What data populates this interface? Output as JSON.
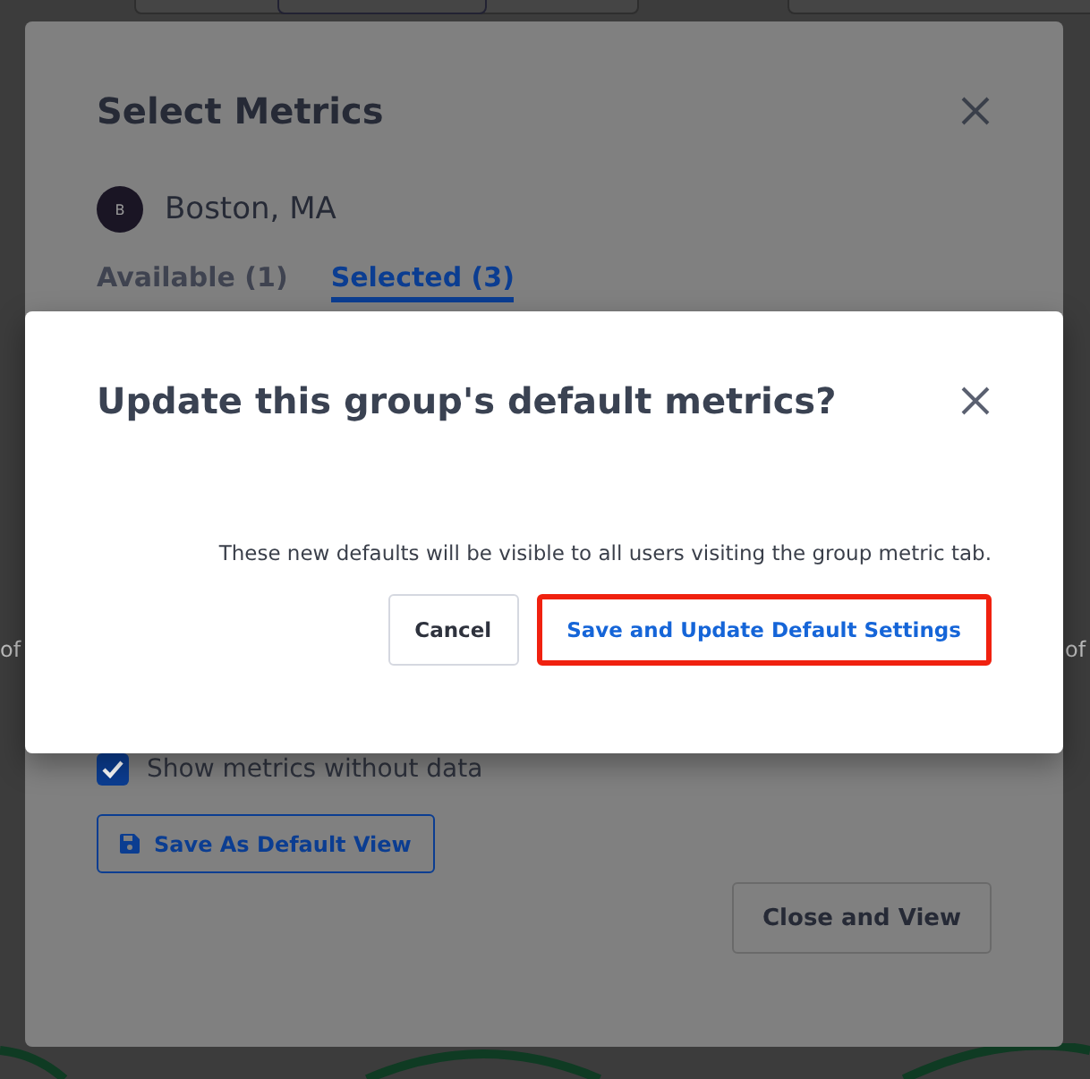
{
  "background": {
    "fragments": [
      {
        "text": "of"
      },
      {
        "text": "of"
      }
    ]
  },
  "select_metrics": {
    "title": "Select Metrics",
    "location": {
      "initial": "B",
      "name": "Boston, MA"
    },
    "tabs": [
      {
        "label": "Available (1)",
        "selected": false
      },
      {
        "label": "Selected (3)",
        "selected": true
      }
    ],
    "show_without_data": {
      "label": "Show metrics without data",
      "checked": true
    },
    "save_default_button": "Save As Default View",
    "close_view_button": "Close and View"
  },
  "confirm_dialog": {
    "title": "Update this group's default metrics?",
    "message": "These new defaults will be visible to all users visiting the group metric tab.",
    "buttons": [
      {
        "label": "Cancel",
        "kind": "secondary"
      },
      {
        "label": "Save and Update Default Settings",
        "kind": "primary",
        "highlighted": true
      }
    ]
  }
}
